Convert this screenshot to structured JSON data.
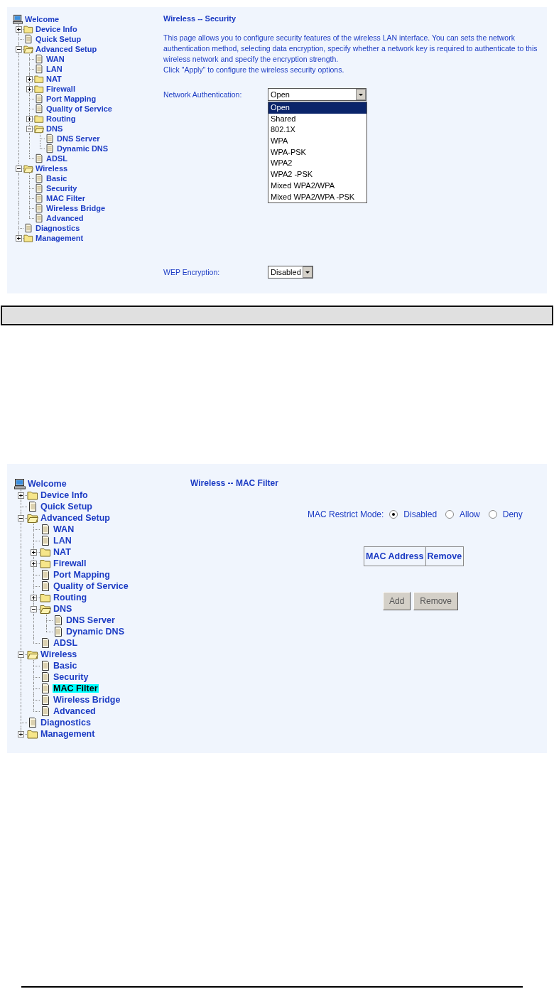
{
  "security_page": {
    "tree": [
      {
        "label": "Welcome",
        "kind": "computer",
        "selected": false
      },
      {
        "label": "Device Info",
        "kind": "folder",
        "expanded": false,
        "selected": false
      },
      {
        "label": "Quick Setup",
        "kind": "page",
        "selected": false
      },
      {
        "label": "Advanced Setup",
        "kind": "folder",
        "expanded": true,
        "selected": false,
        "children": [
          {
            "label": "WAN",
            "kind": "page",
            "selected": false
          },
          {
            "label": "LAN",
            "kind": "page",
            "selected": false
          },
          {
            "label": "NAT",
            "kind": "folder",
            "expanded": false,
            "selected": false
          },
          {
            "label": "Firewall",
            "kind": "folder",
            "expanded": false,
            "selected": false
          },
          {
            "label": "Port Mapping",
            "kind": "page",
            "selected": false
          },
          {
            "label": "Quality of Service",
            "kind": "page",
            "selected": false
          },
          {
            "label": "Routing",
            "kind": "folder",
            "expanded": false,
            "selected": false
          },
          {
            "label": "DNS",
            "kind": "folder",
            "expanded": true,
            "selected": false,
            "children": [
              {
                "label": "DNS Server",
                "kind": "page",
                "selected": false
              },
              {
                "label": "Dynamic DNS",
                "kind": "page",
                "selected": false
              }
            ]
          },
          {
            "label": "ADSL",
            "kind": "page",
            "selected": false
          }
        ]
      },
      {
        "label": "Wireless",
        "kind": "folder",
        "expanded": true,
        "selected": false,
        "children": [
          {
            "label": "Basic",
            "kind": "page",
            "selected": false
          },
          {
            "label": "Security",
            "kind": "page",
            "selected": false
          },
          {
            "label": "MAC Filter",
            "kind": "page",
            "selected": false
          },
          {
            "label": "Wireless Bridge",
            "kind": "page",
            "selected": false
          },
          {
            "label": "Advanced",
            "kind": "page",
            "selected": false
          }
        ]
      },
      {
        "label": "Diagnostics",
        "kind": "page",
        "selected": false
      },
      {
        "label": "Management",
        "kind": "folder",
        "expanded": false,
        "selected": false
      }
    ],
    "title": "Wireless -- Security",
    "description": [
      "This page allows you to configure security features of the wireless LAN interface. You can sets the network authentication method, selecting data encryption, specify whether a network key is required to authenticate to this wireless network and specify the encryption strength.",
      "Click \"Apply\" to configure the wireless security options."
    ],
    "network_authentication": {
      "label": "Network Authentication:",
      "value": "Open",
      "options": [
        {
          "label": "Open",
          "selected": true
        },
        {
          "label": "Shared",
          "selected": false
        },
        {
          "label": "802.1X",
          "selected": false
        },
        {
          "label": "WPA",
          "selected": false
        },
        {
          "label": "WPA-PSK",
          "selected": false
        },
        {
          "label": "WPA2",
          "selected": false
        },
        {
          "label": "WPA2 -PSK",
          "selected": false
        },
        {
          "label": "Mixed WPA2/WPA",
          "selected": false
        },
        {
          "label": "Mixed WPA2/WPA -PSK",
          "selected": false
        }
      ]
    },
    "wep_encryption": {
      "label": "WEP Encryption:",
      "value": "Disabled"
    }
  },
  "mac_filter_page": {
    "tree": [
      {
        "label": "Welcome",
        "kind": "computer",
        "selected": false
      },
      {
        "label": "Device Info",
        "kind": "folder",
        "expanded": false,
        "selected": false
      },
      {
        "label": "Quick Setup",
        "kind": "page",
        "selected": false
      },
      {
        "label": "Advanced Setup",
        "kind": "folder",
        "expanded": true,
        "selected": false,
        "children": [
          {
            "label": "WAN",
            "kind": "page",
            "selected": false
          },
          {
            "label": "LAN",
            "kind": "page",
            "selected": false
          },
          {
            "label": "NAT",
            "kind": "folder",
            "expanded": false,
            "selected": false
          },
          {
            "label": "Firewall",
            "kind": "folder",
            "expanded": false,
            "selected": false
          },
          {
            "label": "Port Mapping",
            "kind": "page",
            "selected": false
          },
          {
            "label": "Quality of Service",
            "kind": "page",
            "selected": false
          },
          {
            "label": "Routing",
            "kind": "folder",
            "expanded": false,
            "selected": false
          },
          {
            "label": "DNS",
            "kind": "folder",
            "expanded": true,
            "selected": false,
            "children": [
              {
                "label": "DNS Server",
                "kind": "page",
                "selected": false
              },
              {
                "label": "Dynamic DNS",
                "kind": "page",
                "selected": false
              }
            ]
          },
          {
            "label": "ADSL",
            "kind": "page",
            "selected": false
          }
        ]
      },
      {
        "label": "Wireless",
        "kind": "folder",
        "expanded": true,
        "selected": false,
        "children": [
          {
            "label": "Basic",
            "kind": "page",
            "selected": false
          },
          {
            "label": "Security",
            "kind": "page",
            "selected": false
          },
          {
            "label": "MAC Filter",
            "kind": "page",
            "selected": true
          },
          {
            "label": "Wireless Bridge",
            "kind": "page",
            "selected": false
          },
          {
            "label": "Advanced",
            "kind": "page",
            "selected": false
          }
        ]
      },
      {
        "label": "Diagnostics",
        "kind": "page",
        "selected": false
      },
      {
        "label": "Management",
        "kind": "folder",
        "expanded": false,
        "selected": false
      }
    ],
    "title": "Wireless -- MAC Filter",
    "restrict_mode": {
      "label": "MAC Restrict Mode:",
      "options": [
        {
          "label": "Disabled",
          "selected": true
        },
        {
          "label": "Allow",
          "selected": false
        },
        {
          "label": "Deny",
          "selected": false
        }
      ]
    },
    "table": {
      "columns": [
        "MAC Address",
        "Remove"
      ]
    },
    "buttons": [
      {
        "label": "Add"
      },
      {
        "label": "Remove"
      }
    ]
  }
}
